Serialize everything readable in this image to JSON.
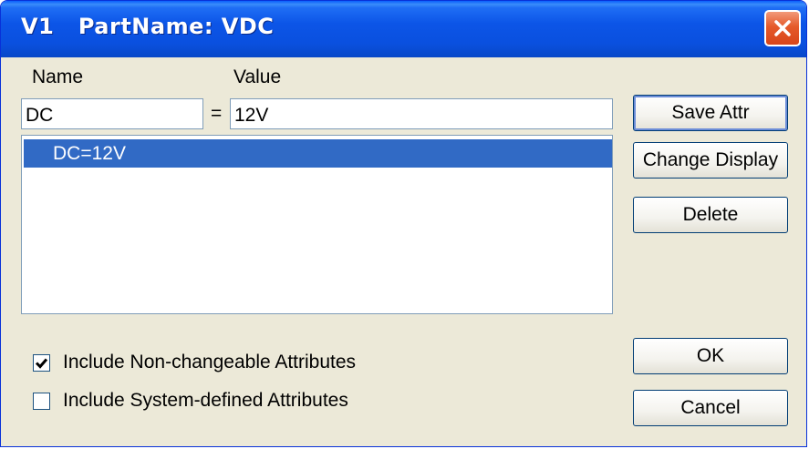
{
  "window": {
    "title": "V1   PartName: VDC"
  },
  "fields": {
    "name_label": "Name",
    "value_label": "Value",
    "equals": "=",
    "name_value": "DC",
    "value_value": "12V"
  },
  "attribute_list": {
    "items": [
      "DC=12V"
    ],
    "selected": "DC=12V"
  },
  "buttons": {
    "save_attr": "Save Attr",
    "change_display": "Change Display",
    "delete": "Delete",
    "ok": "OK",
    "cancel": "Cancel"
  },
  "checkboxes": {
    "non_changeable": {
      "label": "Include Non-changeable Attributes",
      "checked": true
    },
    "system_defined": {
      "label": "Include System-defined Attributes",
      "checked": false
    }
  },
  "icons": {
    "close": "close-icon",
    "check": "checkmark-icon"
  },
  "colors": {
    "title_bar": "#0a50df",
    "close_button": "#e55a2a",
    "selection": "#316ac5",
    "dialog_background": "#ece9d8"
  }
}
